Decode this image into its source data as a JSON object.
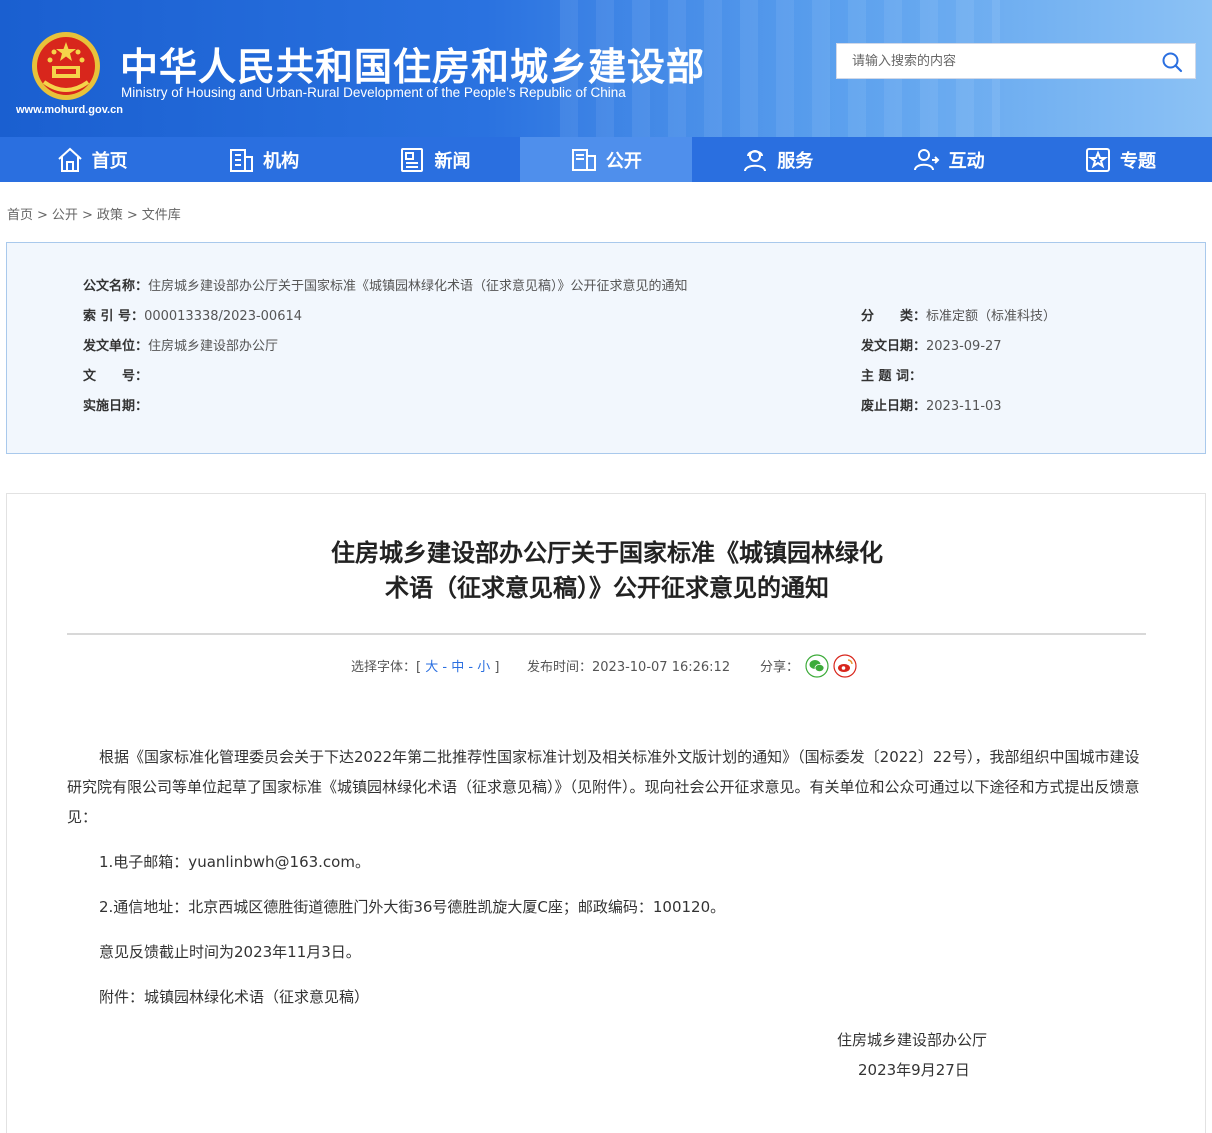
{
  "header": {
    "title_cn": "中华人民共和国住房和城乡建设部",
    "title_en": "Ministry of Housing and Urban-Rural Development of the People’s Republic of China",
    "url": "www.mohurd.gov.cn",
    "search_placeholder": "请输入搜索的内容"
  },
  "nav": [
    {
      "label": "首页",
      "icon": "home-icon"
    },
    {
      "label": "机构",
      "icon": "building-icon"
    },
    {
      "label": "新闻",
      "icon": "news-icon"
    },
    {
      "label": "公开",
      "icon": "open-icon",
      "active": true
    },
    {
      "label": "服务",
      "icon": "service-icon"
    },
    {
      "label": "互动",
      "icon": "interact-icon"
    },
    {
      "label": "专题",
      "icon": "topic-icon"
    }
  ],
  "breadcrumb": [
    "首页",
    "公开",
    "政策",
    "文件库"
  ],
  "info": {
    "name_key": "公文名称：",
    "name_val": "住房城乡建设部办公厅关于国家标准《城镇园林绿化术语（征求意见稿）》公开征求意见的通知",
    "index_key": "索 引 号：",
    "index_val": "000013338/2023-00614",
    "category_key": "分　　类：",
    "category_val": "标准定额（标准科技）",
    "issuer_key": "发文单位：",
    "issuer_val": "住房城乡建设部办公厅",
    "date_key": "发文日期：",
    "date_val": "2023-09-27",
    "docno_key": "文　　号：",
    "docno_val": "",
    "subject_key": "主 题 词：",
    "subject_val": "",
    "impl_key": "实施日期：",
    "impl_val": "",
    "expire_key": "废止日期：",
    "expire_val": "2023-11-03"
  },
  "article": {
    "title_line1": "住房城乡建设部办公厅关于国家标准《城镇园林绿化",
    "title_line2": "术语（征求意见稿）》公开征求意见的通知",
    "font_label": "选择字体：[",
    "font_large": "大",
    "font_mid": "中",
    "font_small": "小",
    "font_close": "]",
    "dash": "-",
    "publish_label": "发布时间：",
    "publish_time": "2023-10-07 16:26:12",
    "share_label": "分享：",
    "para1": "根据《国家标准化管理委员会关于下达2022年第二批推荐性国家标准计划及相关标准外文版计划的通知》（国标委发〔2022〕22号），我部组织中国城市建设研究院有限公司等单位起草了国家标准《城镇园林绿化术语（征求意见稿）》（见附件）。现向社会公开征求意见。有关单位和公众可通过以下途径和方式提出反馈意见：",
    "item1": "1.电子邮箱：yuanlinbwh@163.com。",
    "item2": "2.通信地址：北京西城区德胜街道德胜门外大街36号德胜凯旋大厦C座；邮政编码：100120。",
    "deadline": "意见反馈截止时间为2023年11月3日。",
    "attachment": "附件：城镇园林绿化术语（征求意见稿）",
    "sign_org": "住房城乡建设部办公厅",
    "sign_date": "2023年9月27日"
  },
  "colors": {
    "primary": "#2a6fe0",
    "nav_active": "#4f8fec",
    "info_bg": "#f2f7fd"
  }
}
